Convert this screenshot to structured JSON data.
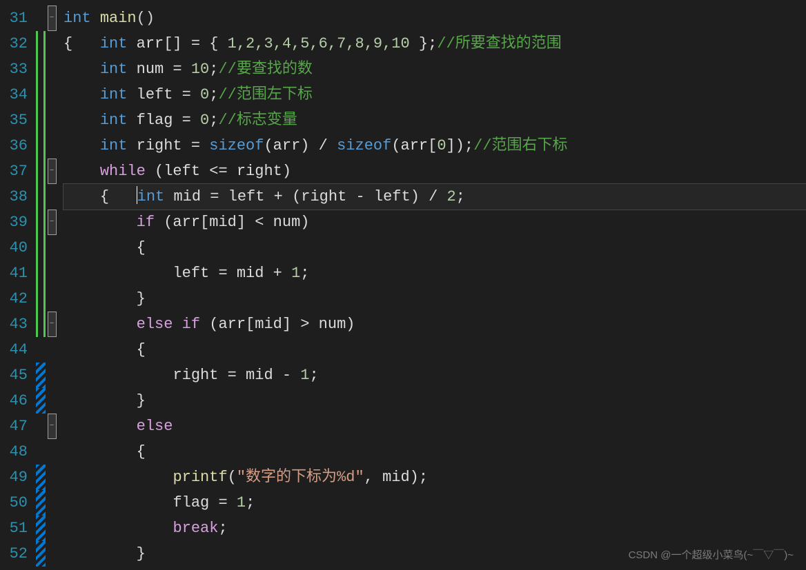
{
  "lineNumbers": [
    "31",
    "32",
    "33",
    "34",
    "35",
    "36",
    "37",
    "38",
    "39",
    "40",
    "41",
    "42",
    "43",
    "44",
    "45",
    "46",
    "47",
    "48",
    "49",
    "50",
    "51",
    "52"
  ],
  "changeMarkers": [
    "",
    "g",
    "g",
    "g",
    "g",
    "g",
    "g",
    "g",
    "g",
    "g",
    "g",
    "g",
    "g",
    "",
    "b",
    "b",
    "",
    "",
    "b",
    "b",
    "b",
    "b"
  ],
  "foldMarkers": [
    "minus",
    "",
    "",
    "",
    "",
    "",
    "minus",
    "",
    "minus",
    "",
    "",
    "",
    "minus",
    "",
    "",
    "",
    "minus",
    "",
    "",
    "",
    "",
    ""
  ],
  "code": {
    "l31": {
      "kw": "int",
      "fn": "main",
      "paren": "()"
    },
    "l32": {
      "brace": "{",
      "kw": "int",
      "ident": "arr",
      "brackets": "[] = { ",
      "nums": "1,2,3,4,5,6,7,8,9,10",
      "end": " };",
      "comment": "//所要查找的范围"
    },
    "l33": {
      "kw": "int",
      "ident": "num",
      "eq": " = ",
      "num": "10",
      "semi": ";",
      "comment": "//要查找的数"
    },
    "l34": {
      "kw": "int",
      "ident": "left",
      "eq": " = ",
      "num": "0",
      "semi": ";",
      "comment": "//范围左下标"
    },
    "l35": {
      "kw": "int",
      "ident": "flag",
      "eq": " = ",
      "num": "0",
      "semi": ";",
      "comment": "//标志变量"
    },
    "l36": {
      "kw": "int",
      "ident": "right",
      "eq": " = ",
      "fn1": "sizeof",
      "p1": "(arr) / ",
      "fn2": "sizeof",
      "p2": "(arr[",
      "num": "0",
      "p3": "]);",
      "comment": "//范围右下标"
    },
    "l37": {
      "kw": "while",
      "expr": " (left <= right)"
    },
    "l38": {
      "brace": "{",
      "kw": "int",
      "ident": "mid",
      "expr": " = left + (right - left) / ",
      "num": "2",
      "semi": ";"
    },
    "l39": {
      "kw": "if",
      "expr": " (arr[mid] < num)"
    },
    "l40": {
      "brace": "{"
    },
    "l41": {
      "expr": "left = mid + ",
      "num": "1",
      "semi": ";"
    },
    "l42": {
      "brace": "}"
    },
    "l43": {
      "kw": "else if",
      "expr": " (arr[mid] > num)"
    },
    "l44": {
      "brace": "{"
    },
    "l45": {
      "expr": "right = mid - ",
      "num": "1",
      "semi": ";"
    },
    "l46": {
      "brace": "}"
    },
    "l47": {
      "kw": "else"
    },
    "l48": {
      "brace": "{"
    },
    "l49": {
      "fn": "printf",
      "p1": "(",
      "str": "\"数字的下标为%d\"",
      "p2": ", mid);"
    },
    "l50": {
      "expr": "flag = ",
      "num": "1",
      "semi": ";"
    },
    "l51": {
      "kw": "break",
      "semi": ";"
    },
    "l52": {
      "brace": "}"
    }
  },
  "watermark": "CSDN @一个超级小菜鸟(~￣▽￣)~"
}
